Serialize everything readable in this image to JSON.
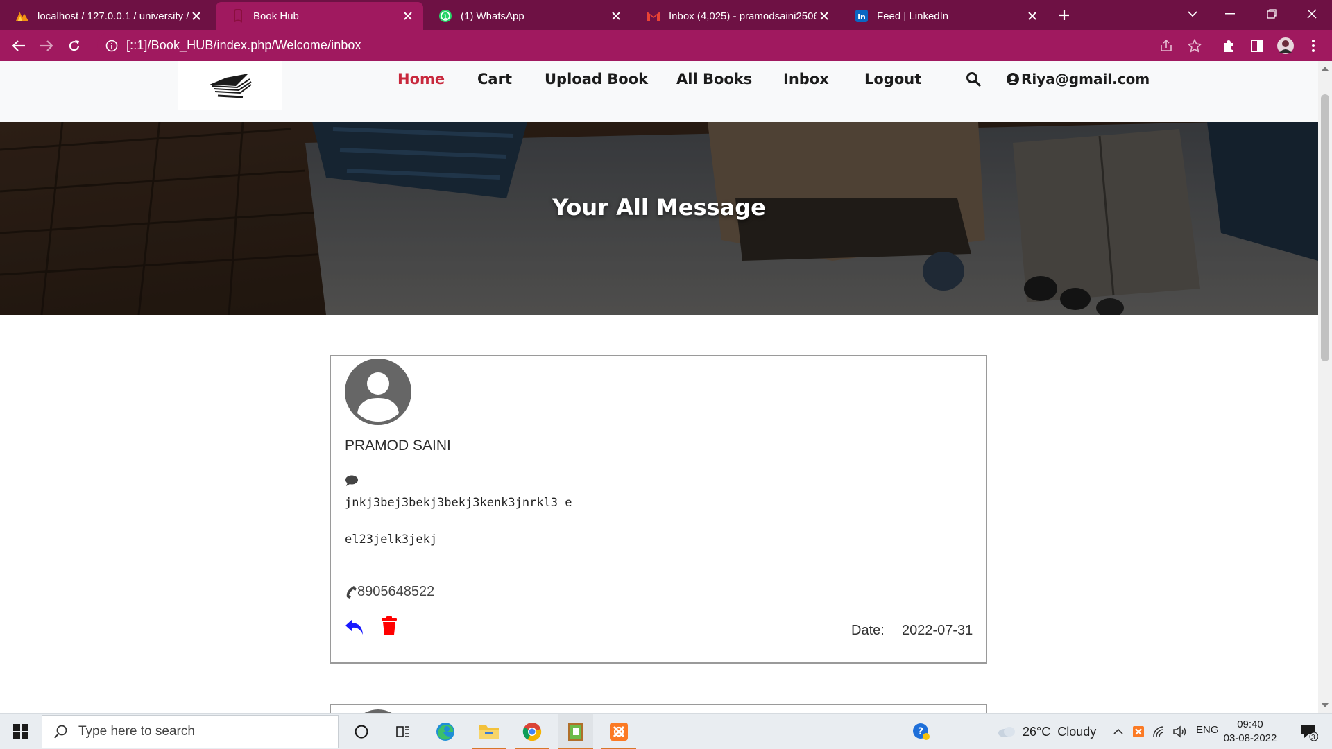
{
  "browser": {
    "tabs": [
      {
        "title": "localhost / 127.0.0.1 / university /",
        "favicon": "phpmyadmin-icon"
      },
      {
        "title": "Book Hub",
        "favicon": "bookhub-icon",
        "active": true
      },
      {
        "title": "(1) WhatsApp",
        "favicon": "whatsapp-icon"
      },
      {
        "title": "Inbox (4,025) - pramodsaini2506",
        "favicon": "gmail-icon"
      },
      {
        "title": "Feed | LinkedIn",
        "favicon": "linkedin-icon"
      }
    ],
    "url": "[::1]/Book_HUB/index.php/Welcome/inbox",
    "theme_color": "#a0195f",
    "tabstrip_color": "#6e1144"
  },
  "site": {
    "nav": [
      {
        "label": "Home",
        "active": true
      },
      {
        "label": "Cart"
      },
      {
        "label": "Upload Book"
      },
      {
        "label": "All Books"
      },
      {
        "label": "Inbox"
      },
      {
        "label": "Logout"
      }
    ],
    "user_email": "Riya@gmail.com",
    "hero_title": "Your All Message",
    "accent_color": "#c8283c"
  },
  "messages": [
    {
      "sender": "PRAMOD SAINI",
      "text_line1": "jnkj3bej3bekj3bekj3kenk3jnrkl3 e",
      "text_line2": "el23jelk3jekj",
      "phone": "8905648522",
      "date_label": "Date:",
      "date": "2022-07-31"
    }
  ],
  "taskbar": {
    "search_placeholder": "Type here to search",
    "weather": "26°C  Cloudy",
    "language": "ENG",
    "time": "09:40",
    "date": "03-08-2022",
    "notifications": "3"
  }
}
